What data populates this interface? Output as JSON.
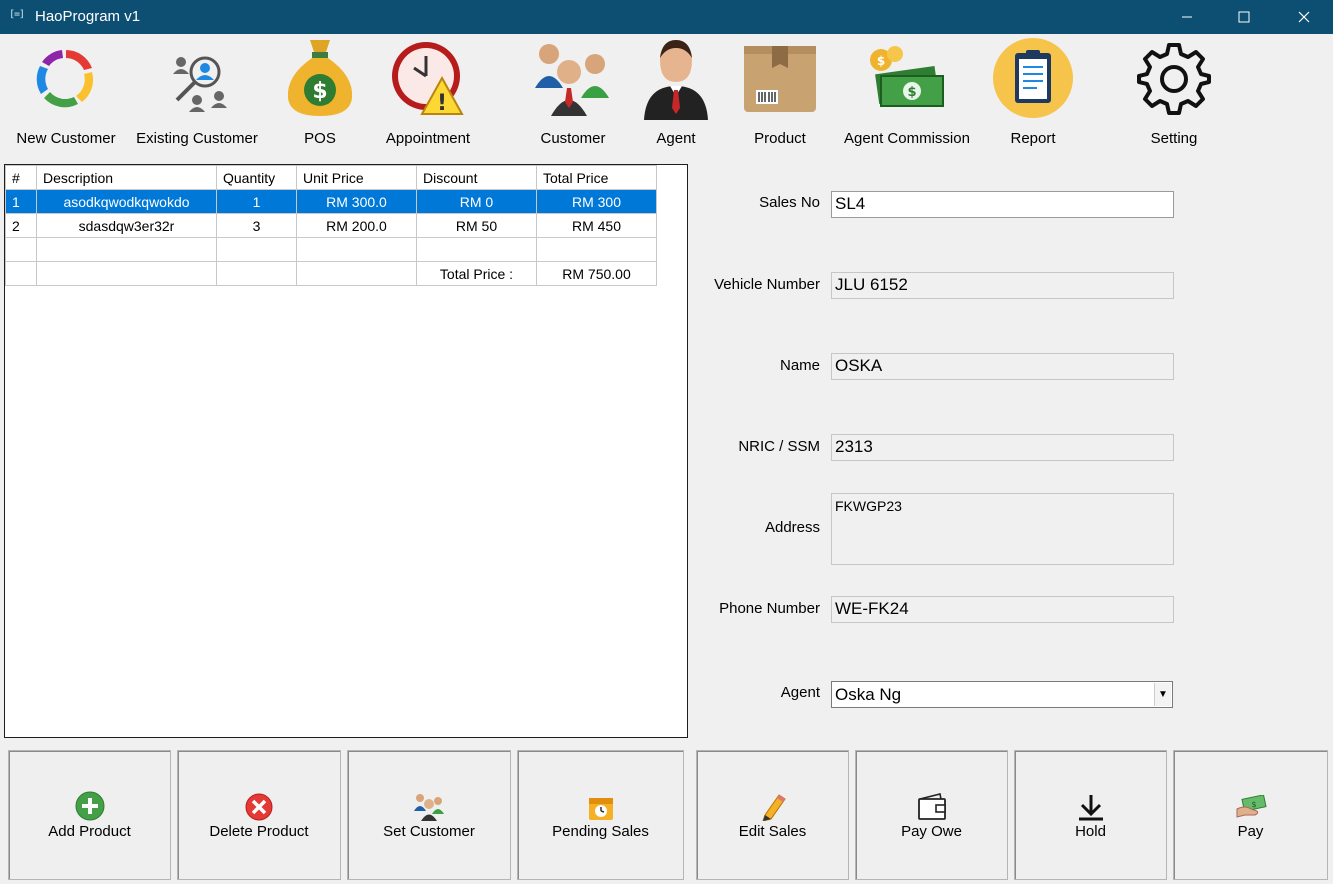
{
  "window": {
    "title": "HaoProgram v1",
    "app_icon_text": "[=]"
  },
  "toolbar": {
    "items": [
      {
        "label": "New Customer",
        "icon": "refresh-cycle-icon"
      },
      {
        "label": "Existing Customer",
        "icon": "user-search-icon"
      },
      {
        "label": "POS",
        "icon": "money-bag-icon"
      },
      {
        "label": "Appointment",
        "icon": "clock-warning-icon"
      },
      {
        "label": "Customer",
        "icon": "people-group-icon"
      },
      {
        "label": "Agent",
        "icon": "businessman-icon"
      },
      {
        "label": "Product",
        "icon": "package-box-icon"
      },
      {
        "label": "Agent Commission",
        "icon": "cash-coins-icon"
      },
      {
        "label": "Report",
        "icon": "clipboard-report-icon"
      },
      {
        "label": "Setting",
        "icon": "gear-icon"
      }
    ]
  },
  "sales_table": {
    "columns": [
      "#",
      "Description",
      "Quantity",
      "Unit Price",
      "Discount",
      "Total Price"
    ],
    "rows": [
      [
        "1",
        "asodkqwodkqwokdo",
        "1",
        "RM 300.0",
        "RM 0",
        "RM 300"
      ],
      [
        "2",
        "sdasdqw3er32r",
        "3",
        "RM 200.0",
        "RM 50",
        "RM 450"
      ]
    ],
    "total_label": "Total Price :",
    "total_value": "RM 750.00"
  },
  "form": {
    "sales_no_label": "Sales No",
    "sales_no": "SL4",
    "vehicle_label": "Vehicle Number",
    "vehicle": "JLU 6152",
    "name_label": "Name",
    "name": "OSKA",
    "nric_label": "NRIC / SSM",
    "nric": "2313",
    "address_label": "Address",
    "address": "FKWGP23",
    "phone_label": "Phone Number",
    "phone": "WE-FK24",
    "agent_label": "Agent",
    "agent": "Oska Ng"
  },
  "actions": {
    "add_product": "Add Product",
    "delete_product": "Delete Product",
    "set_customer": "Set Customer",
    "pending_sales": "Pending Sales",
    "edit_sales": "Edit Sales",
    "pay_owe": "Pay Owe",
    "hold": "Hold",
    "pay": "Pay"
  },
  "colors": {
    "titlebar": "#0d4f72",
    "selection": "#0078d7",
    "background": "#f0f0f0"
  }
}
